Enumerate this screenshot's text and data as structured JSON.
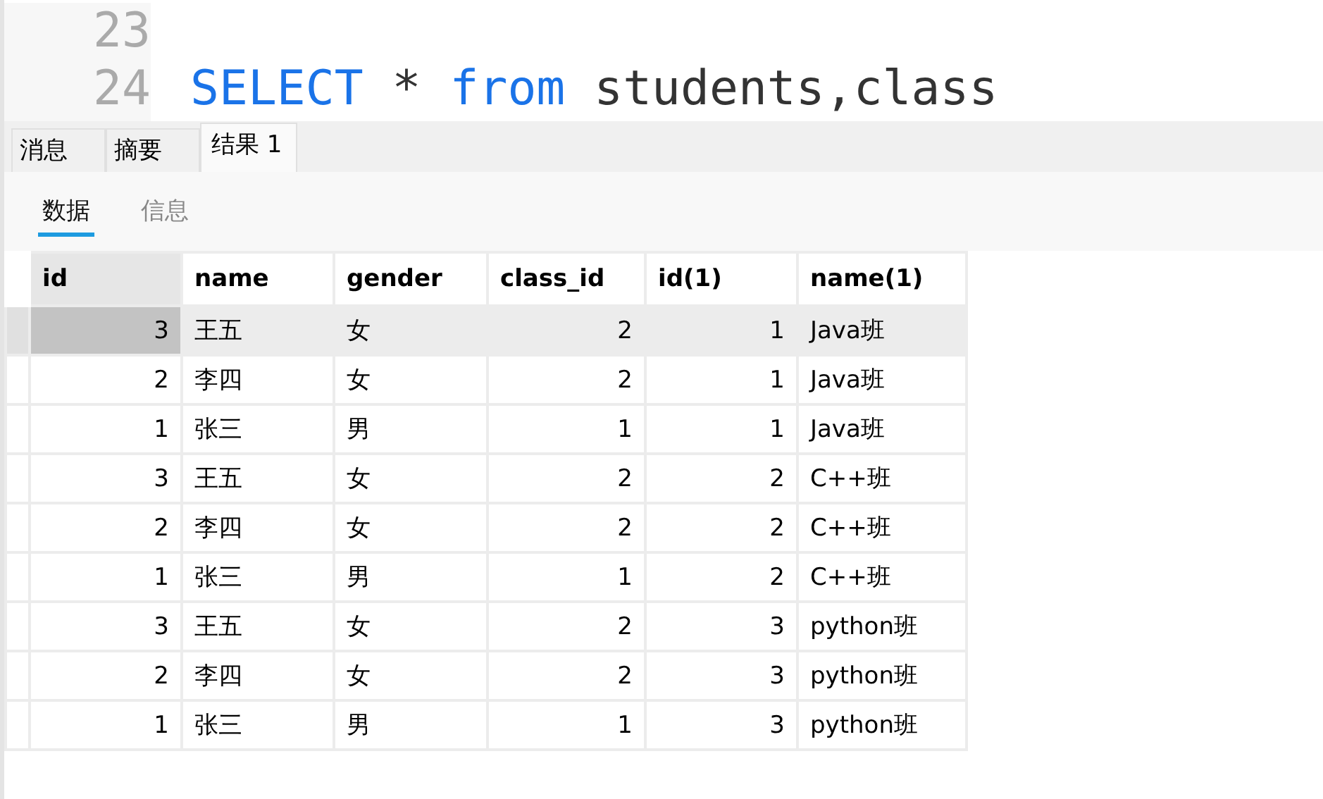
{
  "editor": {
    "lines": [
      {
        "number": "23"
      },
      {
        "number": "24",
        "tokens": [
          {
            "kind": "keyword",
            "text": "SELECT"
          },
          {
            "kind": "plain",
            "text": " * "
          },
          {
            "kind": "keyword",
            "text": "from"
          },
          {
            "kind": "plain",
            "text": " students,class"
          }
        ]
      }
    ]
  },
  "tabs": [
    {
      "label": "消息",
      "selected": false
    },
    {
      "label": "摘要",
      "selected": false
    },
    {
      "label": "结果 1",
      "selected": true
    }
  ],
  "subtabs": [
    {
      "label": "数据",
      "selected": true
    },
    {
      "label": "信息",
      "selected": false
    }
  ],
  "table": {
    "columns": [
      "id",
      "name",
      "gender",
      "class_id",
      "id(1)",
      "name(1)"
    ],
    "rows": [
      {
        "selected": true,
        "cells": [
          "3",
          "王五",
          "女",
          "2",
          "1",
          "Java班"
        ]
      },
      {
        "selected": false,
        "cells": [
          "2",
          "李四",
          "女",
          "2",
          "1",
          "Java班"
        ]
      },
      {
        "selected": false,
        "cells": [
          "1",
          "张三",
          "男",
          "1",
          "1",
          "Java班"
        ]
      },
      {
        "selected": false,
        "cells": [
          "3",
          "王五",
          "女",
          "2",
          "2",
          "C++班"
        ]
      },
      {
        "selected": false,
        "cells": [
          "2",
          "李四",
          "女",
          "2",
          "2",
          "C++班"
        ]
      },
      {
        "selected": false,
        "cells": [
          "1",
          "张三",
          "男",
          "1",
          "2",
          "C++班"
        ]
      },
      {
        "selected": false,
        "cells": [
          "3",
          "王五",
          "女",
          "2",
          "3",
          "python班"
        ]
      },
      {
        "selected": false,
        "cells": [
          "2",
          "李四",
          "女",
          "2",
          "3",
          "python班"
        ]
      },
      {
        "selected": false,
        "cells": [
          "1",
          "张三",
          "男",
          "1",
          "3",
          "python班"
        ]
      }
    ]
  }
}
